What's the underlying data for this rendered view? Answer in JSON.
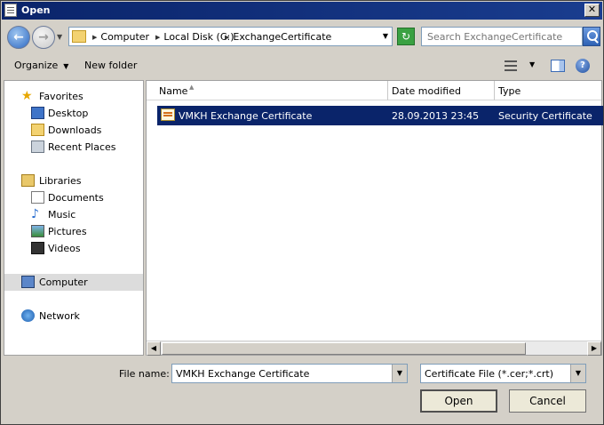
{
  "window": {
    "title": "Open",
    "close_glyph": "✕"
  },
  "address": {
    "crumbs": [
      "Computer",
      "Local Disk (C:)",
      "ExchangeCertificate"
    ],
    "search_placeholder": "Search ExchangeCertificate"
  },
  "toolbar": {
    "organize_label": "Organize",
    "new_folder_label": "New folder"
  },
  "nav": {
    "favorites": "Favorites",
    "desktop": "Desktop",
    "downloads": "Downloads",
    "recent": "Recent Places",
    "libraries": "Libraries",
    "documents": "Documents",
    "music": "Music",
    "pictures": "Pictures",
    "videos": "Videos",
    "computer": "Computer",
    "network": "Network"
  },
  "columns": {
    "name": "Name",
    "date": "Date modified",
    "type": "Type"
  },
  "files": [
    {
      "name": "VMKH Exchange Certificate",
      "date": "28.09.2013 23:45",
      "type": "Security Certificate",
      "selected": true
    }
  ],
  "footer": {
    "filename_label": "File name:",
    "filename_value": "VMKH Exchange Certificate",
    "filter_value": "Certificate File (*.cer;*.crt)",
    "open_label": "Open",
    "cancel_label": "Cancel"
  },
  "icons": {
    "back": "arrow-left-icon",
    "forward": "arrow-right-icon",
    "refresh": "refresh-icon",
    "search": "search-icon",
    "help": "help-icon"
  },
  "colors": {
    "selection": "#0a246a",
    "titlebar": "#0a246a"
  }
}
